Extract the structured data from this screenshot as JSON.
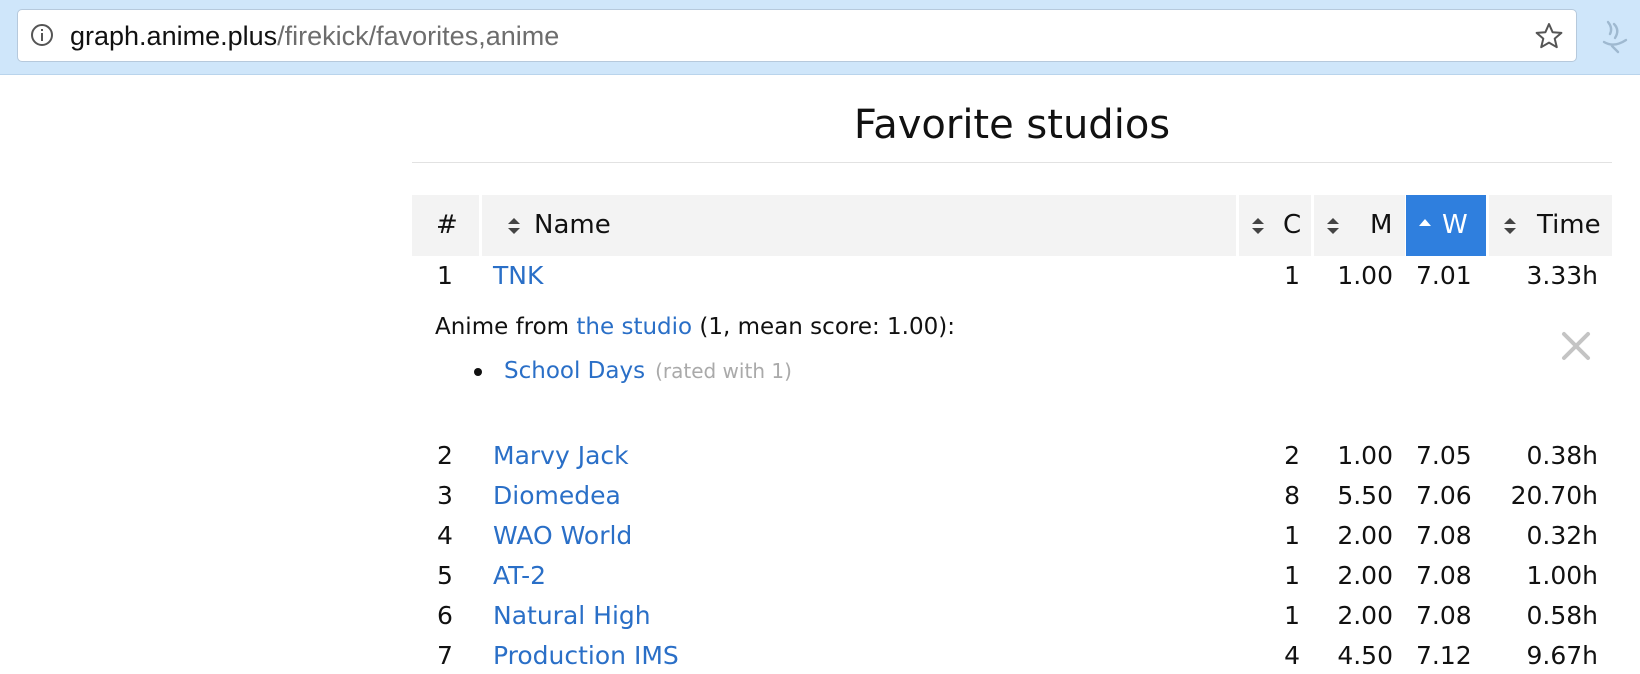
{
  "browser": {
    "url_host": "graph.anime.plus",
    "url_path": "/firekick/favorites,anime",
    "info_icon": "info-icon",
    "bookmark_icon": "star-icon",
    "extension_icon": "extension-icon"
  },
  "page": {
    "title": "Favorite studios"
  },
  "table": {
    "headers": {
      "index": "#",
      "name": "Name",
      "count": "C",
      "mean": "M",
      "weighted": "W",
      "time": "Time"
    },
    "active_sort": "W",
    "accent_color": "#2f7fde",
    "rows": [
      {
        "index": "1",
        "name": "TNK",
        "count": "1",
        "mean": "1.00",
        "weighted": "7.01",
        "time": "3.33h"
      },
      {
        "index": "2",
        "name": "Marvy Jack",
        "count": "2",
        "mean": "1.00",
        "weighted": "7.05",
        "time": "0.38h"
      },
      {
        "index": "3",
        "name": "Diomedea",
        "count": "8",
        "mean": "5.50",
        "weighted": "7.06",
        "time": "20.70h"
      },
      {
        "index": "4",
        "name": "WAO World",
        "count": "1",
        "mean": "2.00",
        "weighted": "7.08",
        "time": "0.32h"
      },
      {
        "index": "5",
        "name": "AT-2",
        "count": "1",
        "mean": "2.00",
        "weighted": "7.08",
        "time": "1.00h"
      },
      {
        "index": "6",
        "name": "Natural High",
        "count": "1",
        "mean": "2.00",
        "weighted": "7.08",
        "time": "0.58h"
      },
      {
        "index": "7",
        "name": "Production IMS",
        "count": "4",
        "mean": "4.50",
        "weighted": "7.12",
        "time": "9.67h"
      }
    ]
  },
  "expanded_detail": {
    "prefix": "Anime from ",
    "link": "the studio",
    "suffix": " (1, mean score: 1.00):",
    "items": [
      {
        "title": "School Days",
        "note": "(rated with 1)"
      }
    ],
    "close_icon": "close-icon"
  }
}
